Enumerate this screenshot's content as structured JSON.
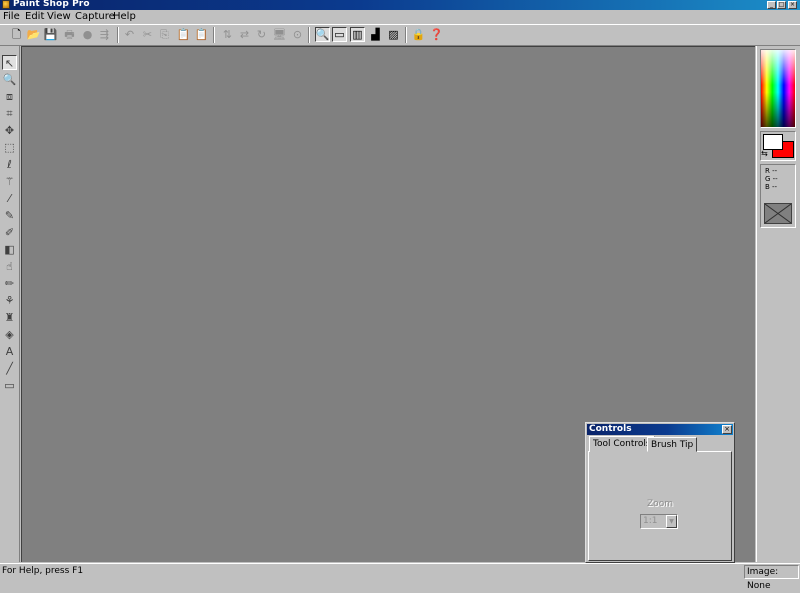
{
  "window": {
    "title": "Paint Shop Pro",
    "minimize_label": "_",
    "maximize_label": "□",
    "close_label": "×"
  },
  "menu": [
    "File",
    "Edit",
    "View",
    "Capture",
    "Help"
  ],
  "toolbar": {
    "buttons": [
      {
        "name": "new-icon",
        "glyph": "🗋",
        "enabled": true
      },
      {
        "name": "open-icon",
        "glyph": "📂",
        "enabled": true
      },
      {
        "name": "save-icon",
        "glyph": "💾",
        "enabled": false
      },
      {
        "name": "print-icon",
        "glyph": "🖶",
        "enabled": false
      },
      {
        "name": "scan-icon",
        "glyph": "●",
        "enabled": false
      },
      {
        "name": "browse-icon",
        "glyph": "⇶",
        "enabled": false
      },
      {
        "name": "undo-icon",
        "glyph": "↶",
        "enabled": false
      },
      {
        "name": "cut-icon",
        "glyph": "✂",
        "enabled": false
      },
      {
        "name": "copy-icon",
        "glyph": "⎘",
        "enabled": false
      },
      {
        "name": "paste-icon",
        "glyph": "📋",
        "enabled": false
      },
      {
        "name": "paste-new-icon",
        "glyph": "📋",
        "enabled": false
      },
      {
        "name": "flip-icon",
        "glyph": "⇅",
        "enabled": false
      },
      {
        "name": "mirror-icon",
        "glyph": "⇄",
        "enabled": false
      },
      {
        "name": "rotate-icon",
        "glyph": "↻",
        "enabled": false
      },
      {
        "name": "full-screen-icon",
        "glyph": "🖥",
        "enabled": false
      },
      {
        "name": "capture-icon",
        "glyph": "⊙",
        "enabled": false
      },
      {
        "name": "toggle-tool-palette-icon",
        "glyph": "🔍",
        "enabled": true,
        "active": true
      },
      {
        "name": "toggle-status-bar-icon",
        "glyph": "▭",
        "enabled": true,
        "active": true
      },
      {
        "name": "toggle-color-palette-icon",
        "glyph": "▥",
        "enabled": true,
        "active": true
      },
      {
        "name": "histogram-icon",
        "glyph": "▟",
        "enabled": true
      },
      {
        "name": "layers-icon",
        "glyph": "▨",
        "enabled": true
      },
      {
        "name": "lock-icon",
        "glyph": "🔒",
        "enabled": true
      },
      {
        "name": "context-help-icon",
        "glyph": "❓",
        "enabled": true
      }
    ]
  },
  "tools": [
    {
      "name": "arrow-tool-icon",
      "glyph": "↖"
    },
    {
      "name": "zoom-tool-icon",
      "glyph": "🔍"
    },
    {
      "name": "deformation-tool-icon",
      "glyph": "⧈"
    },
    {
      "name": "crop-tool-icon",
      "glyph": "⌗"
    },
    {
      "name": "mover-tool-icon",
      "glyph": "✥"
    },
    {
      "name": "selection-tool-icon",
      "glyph": "⬚"
    },
    {
      "name": "freehand-tool-icon",
      "glyph": "ℓ"
    },
    {
      "name": "magic-wand-icon",
      "glyph": "⚚"
    },
    {
      "name": "dropper-icon",
      "glyph": "⁄"
    },
    {
      "name": "paintbrush-icon",
      "glyph": "✎"
    },
    {
      "name": "clone-brush-icon",
      "glyph": "✐"
    },
    {
      "name": "color-replacer-icon",
      "glyph": "◧"
    },
    {
      "name": "retouch-icon",
      "glyph": "☝"
    },
    {
      "name": "eraser-icon",
      "glyph": "✏"
    },
    {
      "name": "picture-tube-icon",
      "glyph": "⚘"
    },
    {
      "name": "airbrush-icon",
      "glyph": "♜"
    },
    {
      "name": "flood-fill-icon",
      "glyph": "◈"
    },
    {
      "name": "text-tool-icon",
      "glyph": "A"
    },
    {
      "name": "line-tool-icon",
      "glyph": "╱"
    },
    {
      "name": "shape-tool-icon",
      "glyph": "▭"
    }
  ],
  "palette": {
    "rgb_labels": [
      "R --",
      "G --",
      "B --"
    ],
    "foreground_color": "#ffffff",
    "background_color": "#ff0000",
    "swap_glyph": "⇆"
  },
  "controls_panel": {
    "title": "Controls",
    "close_label": "×",
    "tabs": [
      "Tool Controls",
      "Brush Tip"
    ],
    "zoom_label": "Zoom",
    "zoom_value": "1:1",
    "zoom_arrow": "▼"
  },
  "status": {
    "help_text": "For Help, press F1",
    "image_text": "Image: None"
  },
  "colors": {
    "workspace": "#808080",
    "title_gradient_start": "#0a246a",
    "title_gradient_end": "#1c8fc9"
  }
}
